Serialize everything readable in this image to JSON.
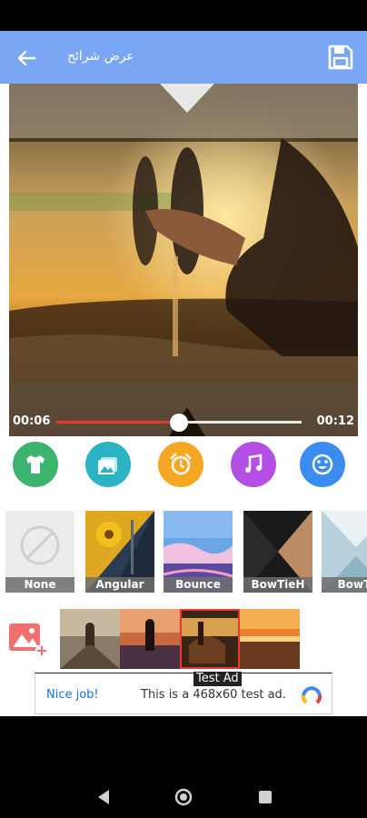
{
  "app_bar": {
    "title": "عرض شرائح",
    "back_icon": "arrow-back-icon",
    "save_icon": "save-icon",
    "color": "#7aa6f4"
  },
  "player": {
    "current_time": "00:06",
    "total_time": "00:12",
    "progress": 0.5,
    "accent": "#e53935"
  },
  "tools": [
    {
      "name": "shirt-icon",
      "color": "#3db46d"
    },
    {
      "name": "gallery-icon",
      "color": "#2bb3c4"
    },
    {
      "name": "alarm-clock-icon",
      "color": "#f5a623"
    },
    {
      "name": "music-note-icon",
      "color": "#b34fe3"
    },
    {
      "name": "smiley-icon",
      "color": "#3b8cf0"
    }
  ],
  "transitions": [
    {
      "label": "None",
      "selected": false
    },
    {
      "label": "Angular",
      "selected": false
    },
    {
      "label": "Bounce",
      "selected": false
    },
    {
      "label": "BowTieH",
      "selected": true
    },
    {
      "label": "BowTi",
      "selected": false
    }
  ],
  "photos": {
    "add_icon": "add-photo-icon",
    "count": 4,
    "selected_index": 2
  },
  "ad": {
    "tag": "Test Ad",
    "left_text": "Nice job!",
    "body_text": "This is a 468x60 test ad.",
    "logo_icon": "ad-logo-icon"
  },
  "nav": {
    "back_icon": "nav-back-icon",
    "home_icon": "nav-home-icon",
    "recents_icon": "nav-recents-icon"
  }
}
